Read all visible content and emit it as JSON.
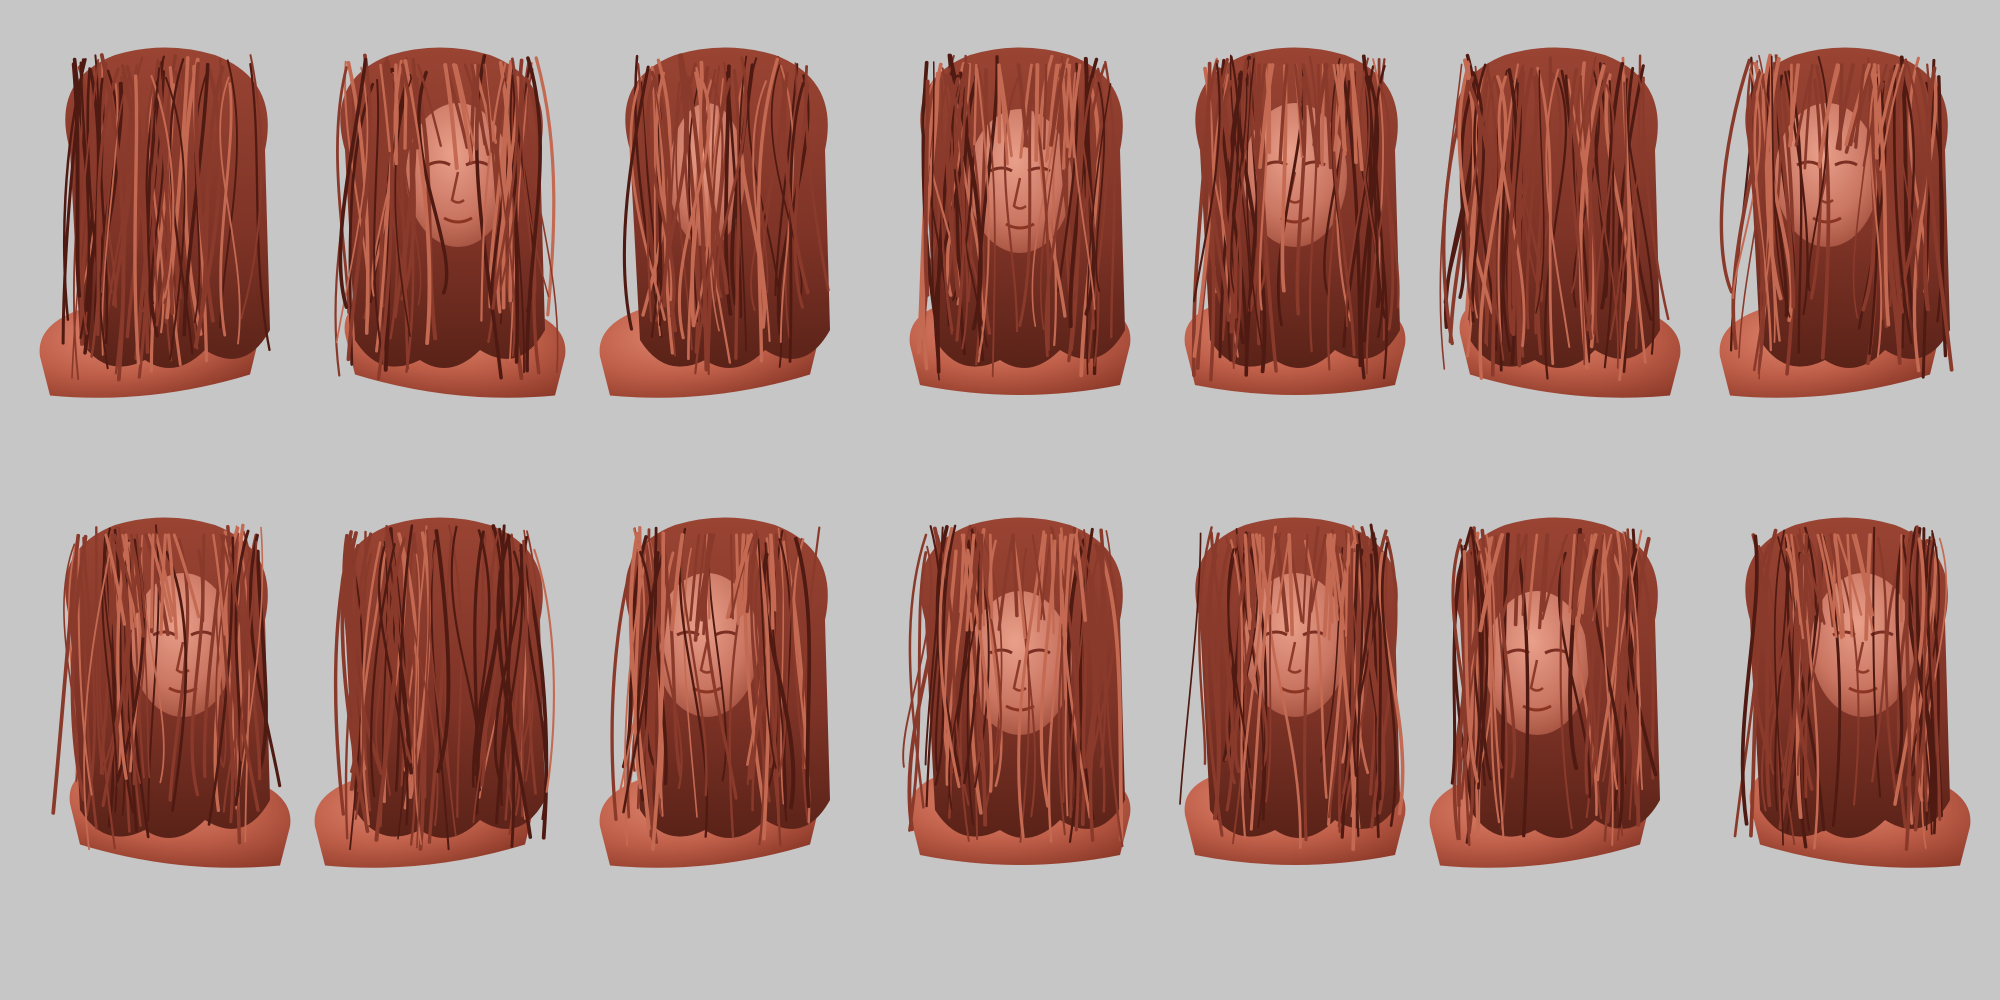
{
  "scene": {
    "background_color": "#c6c6c6",
    "clay_color": "#b0503c",
    "clay_highlight": "#dd8670",
    "hair_color": "#8a3a2b",
    "hair_highlight": "#c46a52",
    "hair_shadow": "#4f1a12"
  },
  "rows": [
    {
      "views": [
        {
          "view": "back-left-three-quarter"
        },
        {
          "view": "front-right-three-quarter"
        },
        {
          "view": "left-profile"
        },
        {
          "view": "front-tilted-up"
        },
        {
          "view": "front"
        },
        {
          "view": "back-right-three-quarter"
        },
        {
          "view": "front-left-tilted"
        }
      ]
    },
    {
      "views": [
        {
          "view": "front-right-three-quarter"
        },
        {
          "view": "back-left-tilted"
        },
        {
          "view": "front-left-three-quarter"
        },
        {
          "view": "front-tilted-down"
        },
        {
          "view": "front"
        },
        {
          "view": "front-tilted-down-left"
        },
        {
          "view": "front-right-three-quarter"
        }
      ]
    }
  ]
}
